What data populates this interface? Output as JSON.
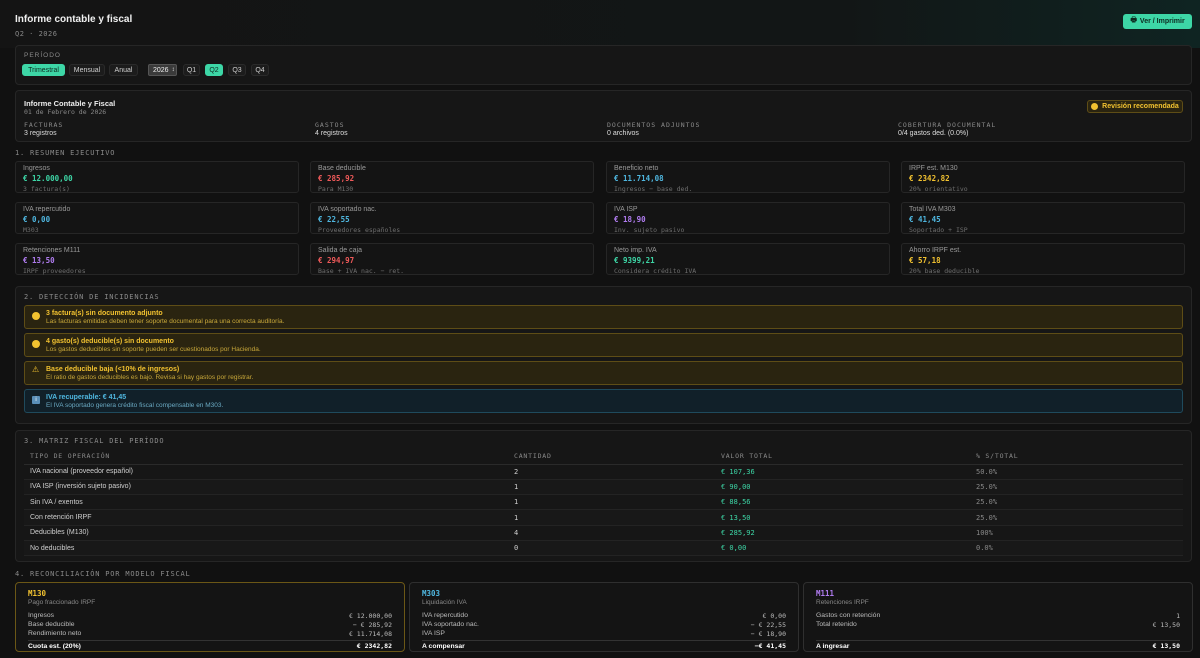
{
  "header": {
    "title": "Informe contable y fiscal",
    "subtitle": "Q2 · 2026",
    "print_label": "Ver / Imprimir"
  },
  "period": {
    "label": "PERÍODO",
    "modes": [
      "Trimestral",
      "Mensual",
      "Anual"
    ],
    "year": "2026",
    "quarters": [
      "Q1",
      "Q2",
      "Q3",
      "Q4"
    ]
  },
  "report": {
    "title": "Informe Contable y Fiscal",
    "date": "01 de Febrero de 2026",
    "badge": "Revisión recomendada",
    "stats": [
      {
        "label": "FACTURAS",
        "value": "3 registros"
      },
      {
        "label": "GASTOS",
        "value": "4 registros"
      },
      {
        "label": "DOCUMENTOS ADJUNTOS",
        "value": "0 archivos"
      },
      {
        "label": "COBERTURA DOCUMENTAL",
        "value": "0/4 gastos ded. (0.0%)"
      }
    ]
  },
  "summary": {
    "title": "1. RESUMEN EJECUTIVO",
    "cards": [
      {
        "label": "Ingresos",
        "value": "€ 12.000,00",
        "sub": "3 factura(s)",
        "color": "#3dd6a6"
      },
      {
        "label": "Base deducible",
        "value": "€ 285,92",
        "sub": "Para M130",
        "color": "#f05a5a"
      },
      {
        "label": "Beneficio neto",
        "value": "€ 11.714,08",
        "sub": "Ingresos − base ded.",
        "color": "#4fb7e0"
      },
      {
        "label": "IRPF est. M130",
        "value": "€ 2342,82",
        "sub": "20% orientativo",
        "color": "#f2c230"
      },
      {
        "label": "IVA repercutido",
        "value": "€ 0,00",
        "sub": "M303",
        "color": "#4fb7e0"
      },
      {
        "label": "IVA soportado nac.",
        "value": "€ 22,55",
        "sub": "Proveedores españoles",
        "color": "#4fb7e0"
      },
      {
        "label": "IVA ISP",
        "value": "€ 18,90",
        "sub": "Inv. sujeto pasivo",
        "color": "#b07cf0"
      },
      {
        "label": "Total IVA M303",
        "value": "€ 41,45",
        "sub": "Soportado + ISP",
        "color": "#4fb7e0"
      },
      {
        "label": "Retenciones M111",
        "value": "€ 13,50",
        "sub": "IRPF proveedores",
        "color": "#b07cf0"
      },
      {
        "label": "Salida de caja",
        "value": "€ 294,97",
        "sub": "Base + IVA nac. − ret.",
        "color": "#f05a5a"
      },
      {
        "label": "Neto imp. IVA",
        "value": "€ 9399,21",
        "sub": "Considera crédito IVA",
        "color": "#3dd6a6"
      },
      {
        "label": "Ahorro IRPF est.",
        "value": "€ 57,18",
        "sub": "20% base deducible",
        "color": "#f2c230"
      }
    ]
  },
  "incidents": {
    "title": "2. DETECCIÓN DE INCIDENCIAS",
    "items": [
      {
        "title": "3 factura(s) sin documento adjunto",
        "desc": "Las facturas emitidas deben tener soporte documental para una correcta auditoría.",
        "kind": "yellow",
        "icon": "yellow-circle-icon"
      },
      {
        "title": "4 gasto(s) deducible(s) sin documento",
        "desc": "Los gastos deducibles sin soporte pueden ser cuestionados por Hacienda.",
        "kind": "yellow",
        "icon": "yellow-circle-icon"
      },
      {
        "title": "Base deducible baja (<10% de ingresos)",
        "desc": "El ratio de gastos deducibles es bajo. Revisa si hay gastos por registrar.",
        "kind": "yellow",
        "icon": "warning-icon"
      },
      {
        "title": "IVA recuperable: € 41,45",
        "desc": "El IVA soportado genera crédito fiscal compensable en M303.",
        "kind": "blue",
        "icon": "info-icon"
      }
    ]
  },
  "matrix": {
    "title": "3. MATRIZ FISCAL DEL PERÍODO",
    "headers": [
      "TIPO DE OPERACIÓN",
      "CANTIDAD",
      "VALOR TOTAL",
      "% S/TOTAL"
    ],
    "rows": [
      [
        "IVA nacional (proveedor español)",
        "2",
        "€ 107,36",
        "50.0%"
      ],
      [
        "IVA ISP (inversión sujeto pasivo)",
        "1",
        "€ 90,00",
        "25.0%"
      ],
      [
        "Sin IVA / exentos",
        "1",
        "€ 88,56",
        "25.0%"
      ],
      [
        "Con retención IRPF",
        "1",
        "€ 13,50",
        "25.0%"
      ],
      [
        "Deducibles (M130)",
        "4",
        "€ 285,92",
        "100%"
      ],
      [
        "No deducibles",
        "0",
        "€ 0,00",
        "0.0%"
      ]
    ]
  },
  "recon": {
    "title": "4. RECONCILIACIÓN POR MODELO FISCAL",
    "models": [
      {
        "code": "M130",
        "name": "Pago fraccionado IRPF",
        "color": "#f2c230",
        "border": "#6b5716",
        "lines": [
          [
            "Ingresos",
            "€ 12.000,00"
          ],
          [
            "Base deducible",
            "− € 285,92"
          ],
          [
            "Rendimiento neto",
            "€ 11.714,08"
          ]
        ],
        "total": [
          "Cuota est. (20%)",
          "€ 2342,82"
        ]
      },
      {
        "code": "M303",
        "name": "Liquidación IVA",
        "color": "#4fb7e0",
        "border": "#2f2f2f",
        "lines": [
          [
            "IVA repercutido",
            "€ 0,00"
          ],
          [
            "IVA soportado nac.",
            "− € 22,55"
          ],
          [
            "IVA ISP",
            "− € 18,90"
          ]
        ],
        "total": [
          "A compensar",
          "−€ 41,45"
        ]
      },
      {
        "code": "M111",
        "name": "Retenciones IRPF",
        "color": "#b07cf0",
        "border": "#2f2f2f",
        "lines": [
          [
            "Gastos con retención",
            "1"
          ],
          [
            "Total retenido",
            "€ 13,50"
          ]
        ],
        "total": [
          "A ingresar",
          "€ 13,50"
        ]
      }
    ]
  }
}
